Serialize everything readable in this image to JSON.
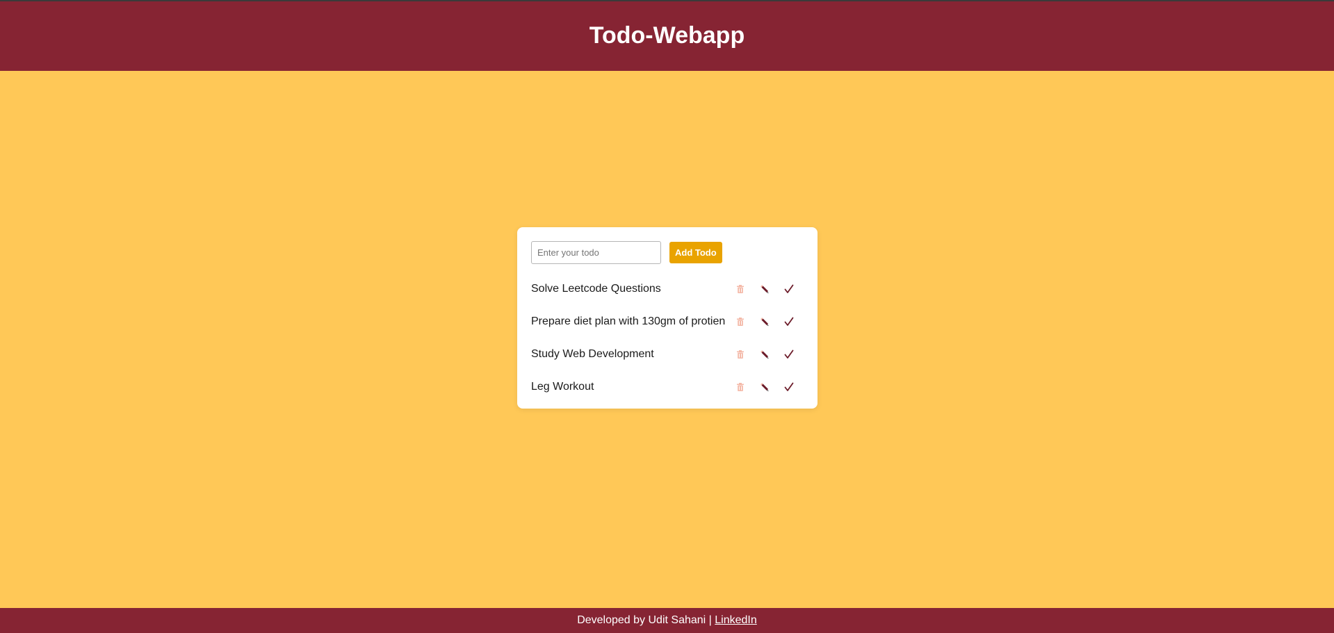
{
  "header": {
    "title": "Todo-Webapp"
  },
  "form": {
    "placeholder": "Enter your todo",
    "value": "",
    "add_label": "Add Todo"
  },
  "todos": [
    {
      "text": "Solve Leetcode Questions"
    },
    {
      "text": "Prepare diet plan with 130gm of protien"
    },
    {
      "text": "Study Web Development"
    },
    {
      "text": "Leg Workout"
    }
  ],
  "icons": {
    "delete": "trash-icon",
    "edit": "pencil-icon",
    "complete": "checkmark-icon"
  },
  "footer": {
    "text": "Developed by Udit Sahani",
    "separator": "|",
    "link_label": "LinkedIn"
  },
  "colors": {
    "header_bg": "#862433",
    "page_bg": "#FFC857",
    "button_bg": "#E9A300",
    "trash_icon": "#F4B9A8",
    "edit_icon": "#6B1A28",
    "check_icon": "#6B1A28"
  }
}
